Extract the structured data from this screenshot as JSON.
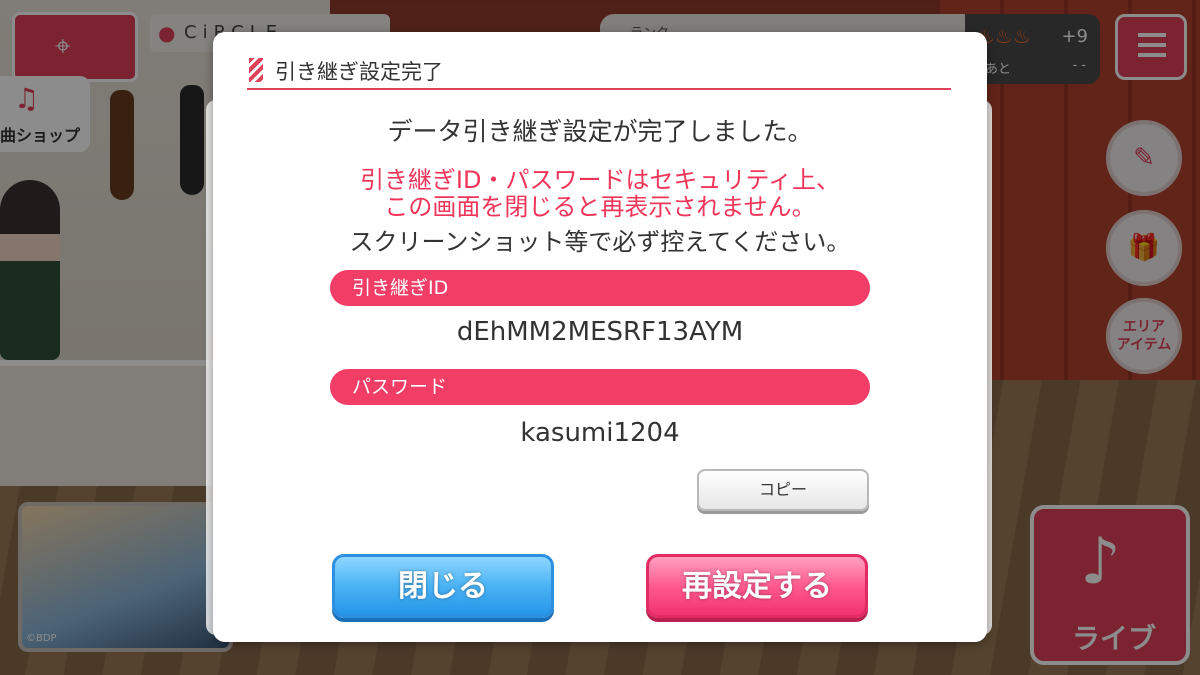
{
  "hud": {
    "location": "CiRCLE",
    "shop_label": "曲ショップ",
    "rank_label": "ランク",
    "stamina_plus": "+9",
    "stamina_remaining_label": "あと",
    "stamina_remaining_value": "- -",
    "area_item_label": "エリア\nアイテム",
    "banner_credit": "©BDP",
    "live_label": "ライブ"
  },
  "modal": {
    "title": "引き継ぎ設定完了",
    "message": "データ引き継ぎ設定が完了しました。",
    "warning": "引き継ぎID・パスワードはセキュリティ上、\nこの画面を閉じると再表示されません。",
    "note": "スクリーンショット等で必ず控えてください。",
    "id_label": "引き継ぎID",
    "id_value": "dEhMM2MESRF13AYM",
    "password_label": "パスワード",
    "password_value": "kasumi1204",
    "copy_label": "コピー",
    "close_label": "閉じる",
    "reset_label": "再設定する"
  },
  "colors": {
    "accent": "#f23d66",
    "close_button": "#4ab3f4",
    "reset_button": "#ff5a8e"
  }
}
